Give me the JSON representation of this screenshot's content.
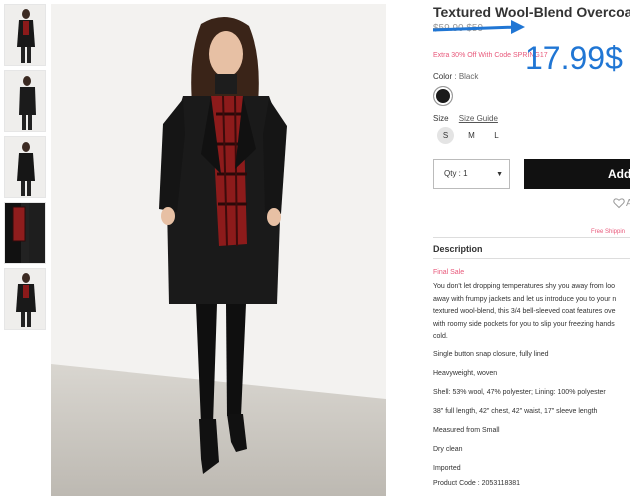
{
  "product": {
    "title": "Textured Wool-Blend Overcoat",
    "old_price": "$59.90 $59",
    "promo": "Extra 30% Off With Code SPRING17",
    "new_price": "17.99$",
    "color_label": "Color",
    "color_value": "Black",
    "size_label": "Size",
    "size_guide": "Size Guide",
    "sizes": [
      "S",
      "M",
      "L"
    ],
    "qty_label": "Qty : 1",
    "qty_caret": "▼",
    "add_label": "Add",
    "wishlist_icon": "heart-icon",
    "wishlist_label": "A",
    "shipping": "Free Shippin",
    "description_title": "Description",
    "final_sale": "Final Sale",
    "blurb_lines": [
      "You don't let dropping temperatures shy you away from loo",
      "away with frumpy jackets and let us introduce you to your n",
      "textured wool-blend, this 3/4 bell-sleeved coat features ove",
      "with roomy side pockets for you to slip your freezing hands",
      "cold."
    ],
    "details": [
      "Single button snap closure, fully lined",
      "Heavyweight, woven",
      "Shell: 53% wool, 47% polyester; Lining: 100% polyester",
      "38\" full length, 42\" chest, 42\" waist, 17\" sleeve length",
      "Measured from Small",
      "Dry clean",
      "Imported",
      "Product Code : 2053118381"
    ]
  },
  "colors": {
    "accent_price": "#2076d4",
    "promo_pink": "#e8587a",
    "button_black": "#111111"
  }
}
